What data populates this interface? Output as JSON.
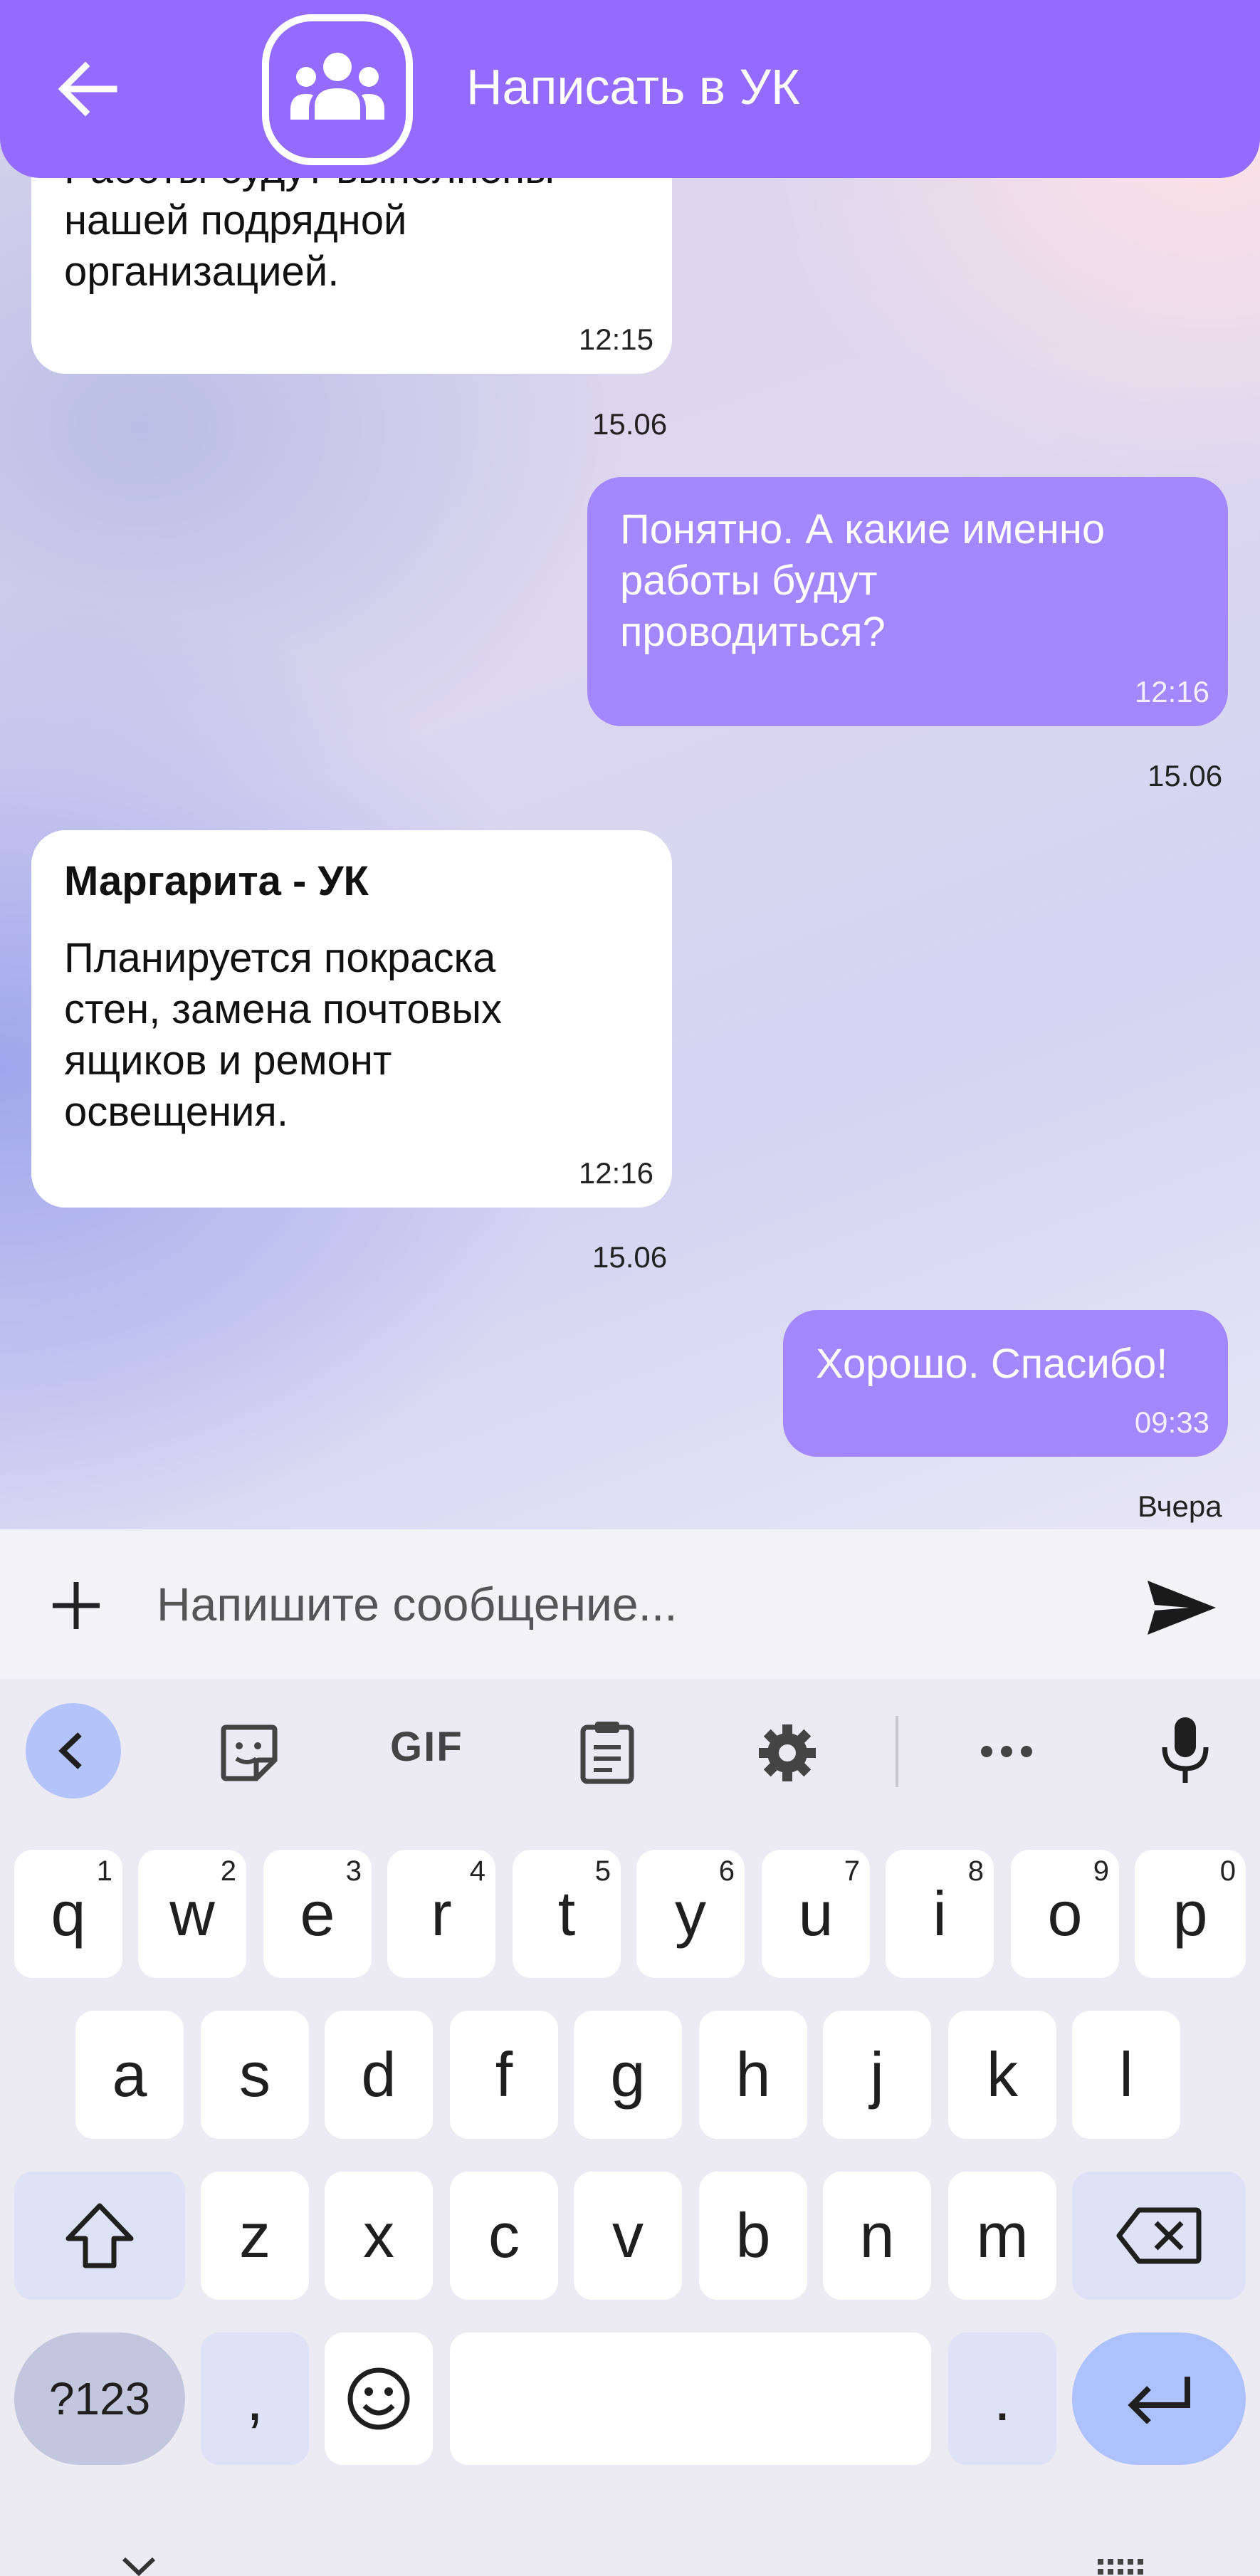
{
  "header": {
    "title": "Написать в УК"
  },
  "messages": [
    {
      "direction": "incoming",
      "sender": "",
      "lines": [
        "Работы будут выполнены",
        "нашей подрядной",
        "организацией."
      ],
      "time": "12:15",
      "date": "15.06"
    },
    {
      "direction": "outgoing",
      "lines": [
        "Понятно. А какие именно",
        "работы будут",
        "проводиться?"
      ],
      "time": "12:16",
      "date": "15.06"
    },
    {
      "direction": "incoming",
      "sender": "Маргарита - УК",
      "lines": [
        "Планируется покраска",
        "стен, замена почтовых",
        "ящиков и ремонт",
        "освещения."
      ],
      "time": "12:16",
      "date": "15.06"
    },
    {
      "direction": "outgoing",
      "lines": [
        "Хорошо. Спасибо!"
      ],
      "time": "09:33",
      "date": "Вчера"
    }
  ],
  "composer": {
    "placeholder": "Напишите сообщение..."
  },
  "keyboard": {
    "toolbar": {
      "gif_label": "GIF"
    },
    "row1": [
      {
        "key": "q",
        "hint": "1"
      },
      {
        "key": "w",
        "hint": "2"
      },
      {
        "key": "e",
        "hint": "3"
      },
      {
        "key": "r",
        "hint": "4"
      },
      {
        "key": "t",
        "hint": "5"
      },
      {
        "key": "y",
        "hint": "6"
      },
      {
        "key": "u",
        "hint": "7"
      },
      {
        "key": "i",
        "hint": "8"
      },
      {
        "key": "o",
        "hint": "9"
      },
      {
        "key": "p",
        "hint": "0"
      }
    ],
    "row2": [
      "a",
      "s",
      "d",
      "f",
      "g",
      "h",
      "j",
      "k",
      "l"
    ],
    "row3": [
      "z",
      "x",
      "c",
      "v",
      "b",
      "n",
      "m"
    ],
    "symbols_label": "?123",
    "comma": ",",
    "period": "."
  },
  "colors": {
    "header": "#946cfd",
    "outgoing_bubble": "#a387ff",
    "incoming_bubble": "#ffffff",
    "enter_key": "#adc2fd"
  }
}
